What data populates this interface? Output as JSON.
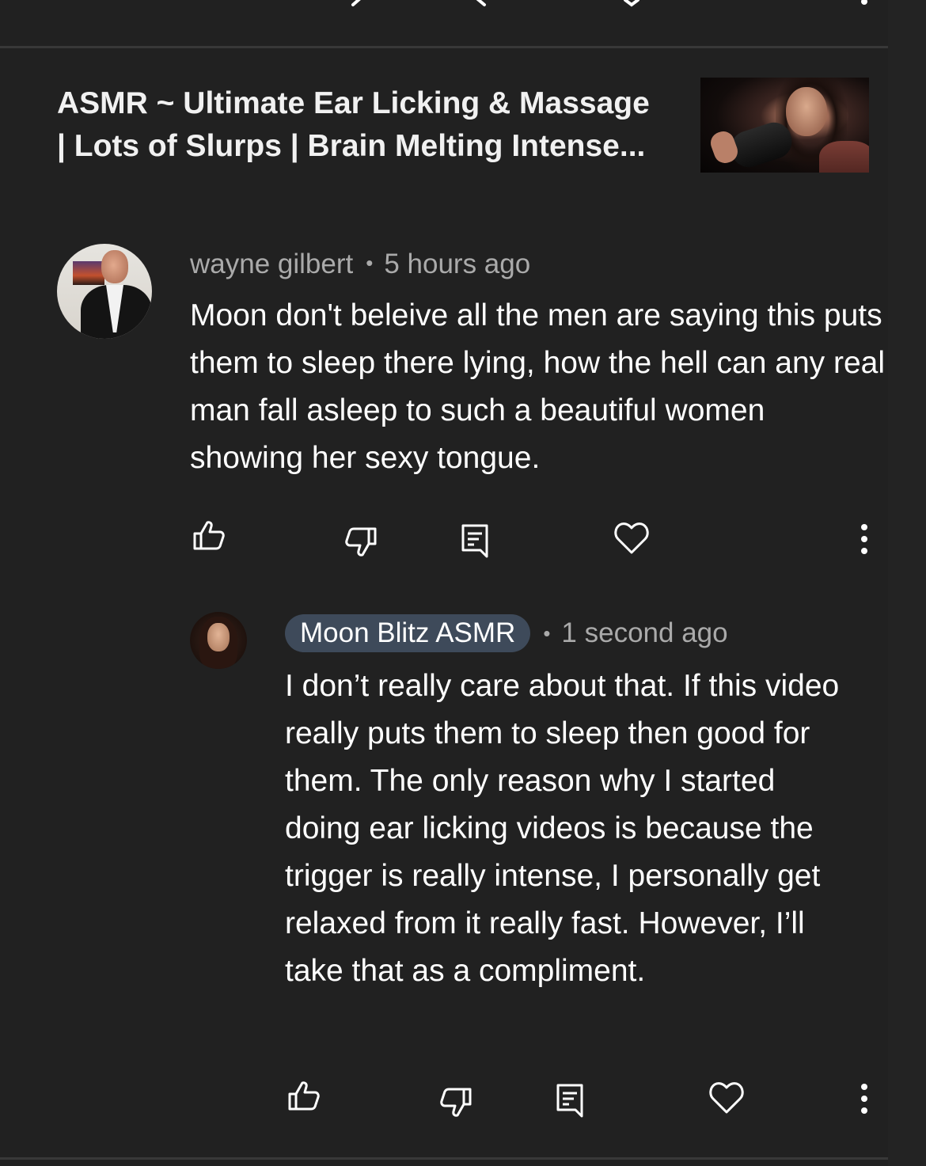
{
  "video": {
    "title": "ASMR ~ Ultimate Ear Licking & Massage\n| Lots of Slurps | Brain Melting Intense..."
  },
  "comments": [
    {
      "author": "wayne gilbert",
      "time": "5 hours ago",
      "text": "Moon don't beleive all the men are saying this puts them to sleep there lying, how the hell can any real man fall asleep to such a beautiful women showing her sexy tongue."
    },
    {
      "author": "Moon Blitz ASMR",
      "author_is_creator": true,
      "time": "1 second ago",
      "text": "I don’t really care about that. If this video really puts them to sleep then good for them. The only reason why I started doing ear licking videos is because the trigger is really intense, I personally get relaxed from it really fast. However, I’ll take that as a compliment."
    }
  ],
  "separator": "•",
  "actions": [
    "like-icon",
    "dislike-icon",
    "reply-icon",
    "heart-icon",
    "more-icon"
  ],
  "colors": {
    "background": "#212121",
    "meta_text": "#aaaaaa",
    "creator_chip": "#3e4a5a"
  }
}
